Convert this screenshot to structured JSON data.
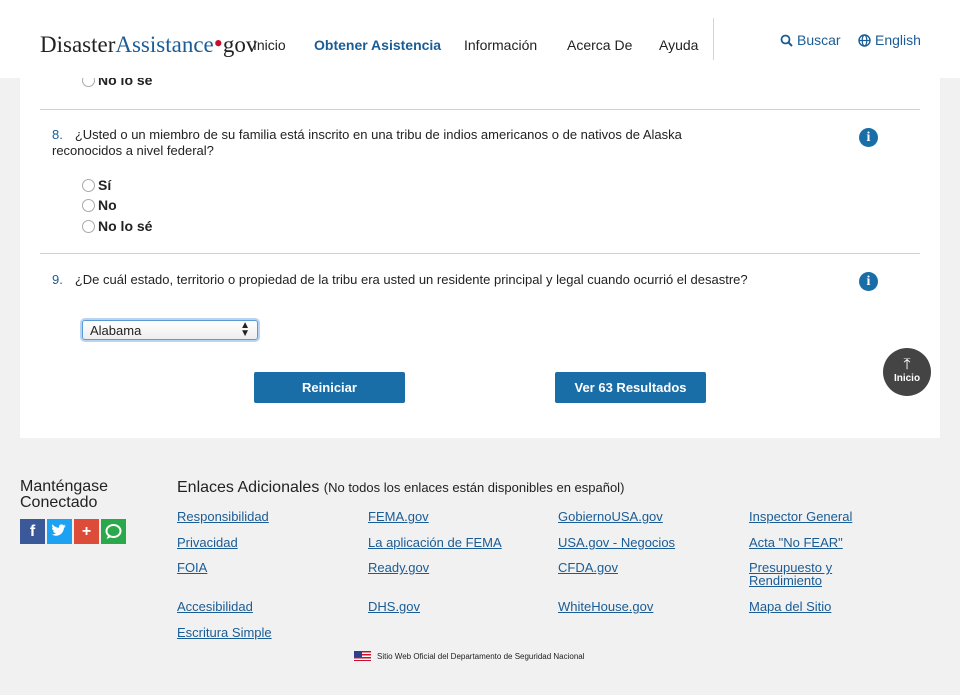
{
  "header": {
    "logo_part1": "Disaster",
    "logo_part2": "Assistance",
    "logo_dot": "•",
    "logo_part3": "gov",
    "nav": [
      "Inicio",
      "Obtener Asistencia",
      "Información",
      "Acerca De",
      "Ayuda"
    ],
    "search_label": "Buscar",
    "language_label": "English"
  },
  "q7_partial": {
    "option_label": "No lo sé"
  },
  "q8": {
    "number": "8.",
    "text": "¿Usted o un miembro de su familia está inscrito en una tribu de indios americanos o de nativos de Alaska reconocidos a nivel federal?",
    "options": [
      "Sí",
      "No",
      "No lo sé"
    ]
  },
  "q9": {
    "number": "9.",
    "text": "¿De cuál estado, territorio o propiedad de la tribu era usted un residente principal y legal cuando ocurrió el desastre?",
    "selected": "Alabama"
  },
  "actions": {
    "reset": "Reiniciar",
    "results": "Ver 63 Resultados"
  },
  "back_to_top": "Inicio",
  "footer": {
    "stay_connected": "Manténgase Conectado",
    "links_title": "Enlaces Adicionales",
    "links_note": "(No todos los enlaces están disponibles en español)",
    "links": {
      "col1": [
        "Responsibilidad",
        "Privacidad",
        "FOIA",
        "Accesibilidad",
        "Escritura Simple"
      ],
      "col2": [
        "FEMA.gov",
        "La aplicación de FEMA",
        "Ready.gov",
        "DHS.gov"
      ],
      "col3": [
        "GobiernoUSA.gov",
        "USA.gov - Negocios",
        "CFDA.gov",
        "WhiteHouse.gov"
      ],
      "col4": [
        "Inspector General",
        "Acta \"No FEAR\"",
        "Presupuesto y Rendimiento",
        "Mapa del Sitio"
      ]
    },
    "official": "Sitio Web Oficial del Departamento de Seguridad Nacional"
  },
  "colors": {
    "brand_blue": "#1a6ea8",
    "link_blue": "#1a5c96",
    "logo_red": "#c8102e"
  }
}
